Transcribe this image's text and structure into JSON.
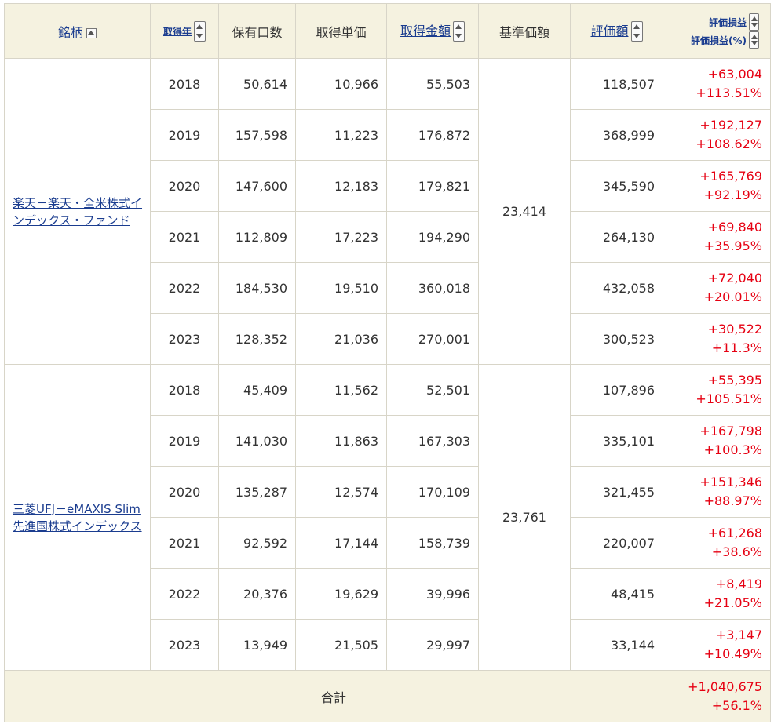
{
  "headers": {
    "name": "銘柄",
    "year": "取得年",
    "units": "保有口数",
    "unit_price": "取得単価",
    "cost": "取得金額",
    "base_price": "基準価額",
    "value": "評価額",
    "pl": "評価損益",
    "pl_pct": "評価損益(%)"
  },
  "funds": [
    {
      "name": "楽天－楽天・全米株式インデックス・ファンド",
      "base_price": "23,414",
      "rows": [
        {
          "year": "2018",
          "units": "50,614",
          "unit_price": "10,966",
          "cost": "55,503",
          "value": "118,507",
          "pl": "+63,004",
          "pl_pct": "+113.51%"
        },
        {
          "year": "2019",
          "units": "157,598",
          "unit_price": "11,223",
          "cost": "176,872",
          "value": "368,999",
          "pl": "+192,127",
          "pl_pct": "+108.62%"
        },
        {
          "year": "2020",
          "units": "147,600",
          "unit_price": "12,183",
          "cost": "179,821",
          "value": "345,590",
          "pl": "+165,769",
          "pl_pct": "+92.19%"
        },
        {
          "year": "2021",
          "units": "112,809",
          "unit_price": "17,223",
          "cost": "194,290",
          "value": "264,130",
          "pl": "+69,840",
          "pl_pct": "+35.95%"
        },
        {
          "year": "2022",
          "units": "184,530",
          "unit_price": "19,510",
          "cost": "360,018",
          "value": "432,058",
          "pl": "+72,040",
          "pl_pct": "+20.01%"
        },
        {
          "year": "2023",
          "units": "128,352",
          "unit_price": "21,036",
          "cost": "270,001",
          "value": "300,523",
          "pl": "+30,522",
          "pl_pct": "+11.3%"
        }
      ]
    },
    {
      "name": "三菱UFJ－eMAXIS Slim 先進国株式インデックス",
      "base_price": "23,761",
      "rows": [
        {
          "year": "2018",
          "units": "45,409",
          "unit_price": "11,562",
          "cost": "52,501",
          "value": "107,896",
          "pl": "+55,395",
          "pl_pct": "+105.51%"
        },
        {
          "year": "2019",
          "units": "141,030",
          "unit_price": "11,863",
          "cost": "167,303",
          "value": "335,101",
          "pl": "+167,798",
          "pl_pct": "+100.3%"
        },
        {
          "year": "2020",
          "units": "135,287",
          "unit_price": "12,574",
          "cost": "170,109",
          "value": "321,455",
          "pl": "+151,346",
          "pl_pct": "+88.97%"
        },
        {
          "year": "2021",
          "units": "92,592",
          "unit_price": "17,144",
          "cost": "158,739",
          "value": "220,007",
          "pl": "+61,268",
          "pl_pct": "+38.6%"
        },
        {
          "year": "2022",
          "units": "20,376",
          "unit_price": "19,629",
          "cost": "39,996",
          "value": "48,415",
          "pl": "+8,419",
          "pl_pct": "+21.05%"
        },
        {
          "year": "2023",
          "units": "13,949",
          "unit_price": "21,505",
          "cost": "29,997",
          "value": "33,144",
          "pl": "+3,147",
          "pl_pct": "+10.49%"
        }
      ]
    }
  ],
  "total": {
    "label": "合計",
    "pl": "+1,040,675",
    "pl_pct": "+56.1%"
  },
  "colors": {
    "header_bg": "#f5f2e0",
    "link": "#1a3c8f",
    "gain": "#e60012",
    "border": "#d8d5c8"
  }
}
